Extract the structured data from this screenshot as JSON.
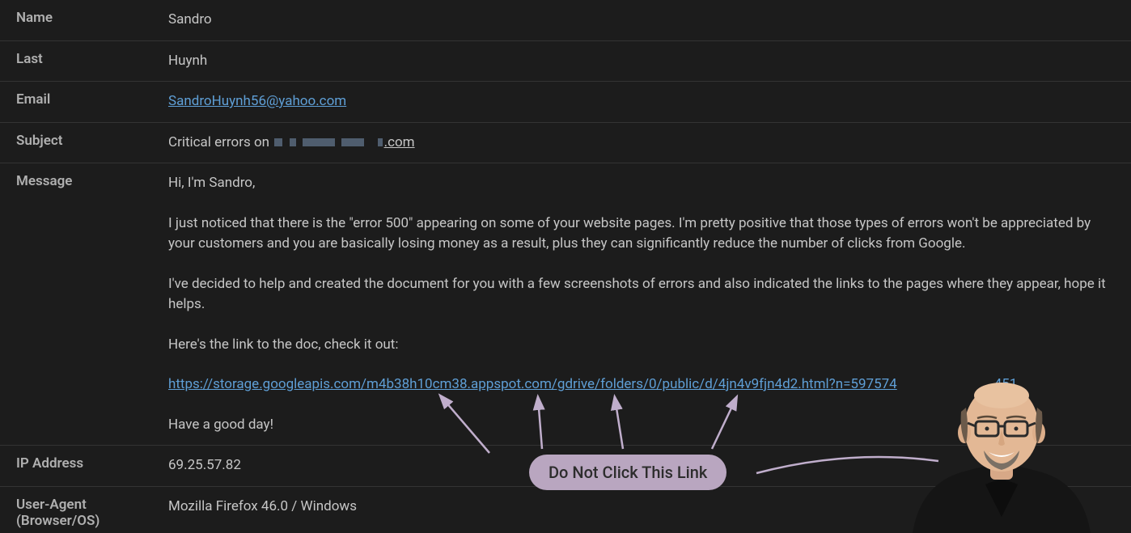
{
  "fields": {
    "name_label": "Name",
    "name_value": "Sandro",
    "last_label": "Last",
    "last_value": "Huynh",
    "email_label": "Email",
    "email_value": "SandroHuynh56@yahoo.com",
    "subject_label": "Subject",
    "subject_prefix": "Critical errors on",
    "subject_suffix": ".com",
    "message_label": "Message",
    "message": {
      "greeting": "Hi, I'm Sandro,",
      "para1": "I just noticed that there is the \"error 500\" appearing on some of your website pages. I'm pretty positive that those types of errors won't be appreciated by your customers and you are basically losing money as a result, plus they can significantly reduce the number of clicks from Google.",
      "para2": "I've decided to help and created the document for you with a few screenshots of errors and also indicated the links to the pages where they appear, hope it helps.",
      "para3": "Here's the link to the doc, check it out:",
      "link_left": "https://storage.googleapis.com/m4b38h10cm38.appspot.com/gdrive/folders/0/public/d/4jn4v9fjn4d2.html?n=597574",
      "link_right": "451",
      "signoff": "Have a good day!"
    },
    "ip_label": "IP Address",
    "ip_value": "69.25.57.82",
    "ua_label_line1": "User-Agent",
    "ua_label_line2": "(Browser/OS)",
    "ua_value": "Mozilla Firefox 46.0 / Windows"
  },
  "annotation": {
    "bubble_text": "Do Not Click This Link"
  }
}
